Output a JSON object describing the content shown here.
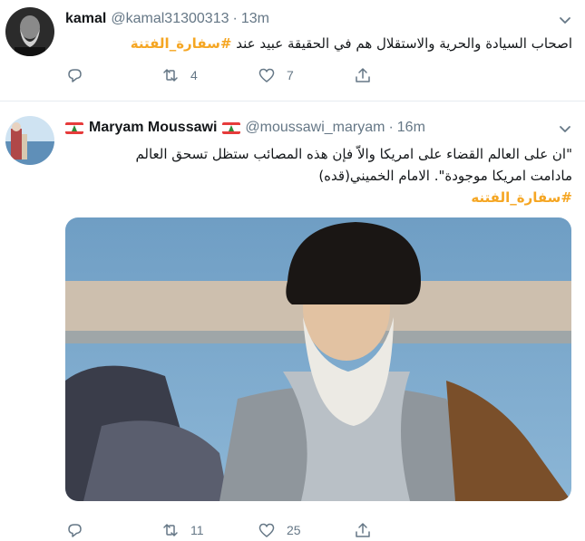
{
  "tweets": [
    {
      "name": "kamal",
      "handle": "@kamal31300313",
      "dot": "·",
      "time": "13m",
      "text_lines": [
        "اصحاب السيادة والحرية والاستقلال هم في الحقيقة عبيد عند #سفارة_الفتنة"
      ],
      "hashtag": "#سفارة_الفتنة",
      "text_prefix": "اصحاب السيادة والحرية والاستقلال هم في الحقيقة عبيد عند ",
      "actions": {
        "reply": "",
        "retweet": "4",
        "like": "7"
      }
    },
    {
      "name": "Maryam Moussawi",
      "handle": "@moussawi_maryam",
      "dot": "·",
      "time": "16m",
      "line1": "\"ان على العالم القضاء على امريكا والاّ فإن هذه المصائب ستظل تسحق العالم",
      "line2": "مادامت امريكا موجودة\". الامام الخميني(قده)",
      "hashtag": "#سفارة_الفتنه",
      "actions": {
        "reply": "",
        "retweet": "11",
        "like": "25"
      }
    }
  ],
  "colors": {
    "hashtag": "#f5a623",
    "muted": "#657786",
    "divider": "#e6ecf0"
  },
  "icons": [
    "reply-icon",
    "retweet-icon",
    "like-icon",
    "share-icon",
    "chevron-down-icon",
    "lebanon-flag-icon"
  ]
}
